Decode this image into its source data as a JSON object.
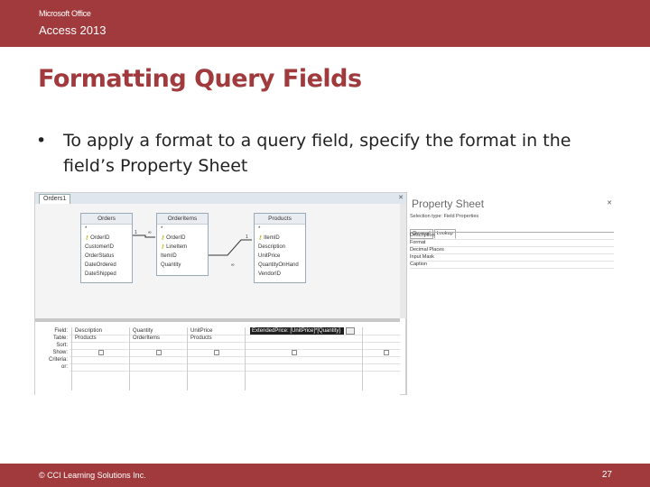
{
  "header": {
    "brand": "Microsoft Office",
    "product": "Access 2013"
  },
  "slide": {
    "title": "Formatting Query Fields",
    "bullet_mark": "•",
    "bullet": "To apply a format to a query field, specify the format in the field’s Property Sheet"
  },
  "footer": {
    "copyright": "© CCI Learning Solutions Inc.",
    "page": "27"
  },
  "screenshot": {
    "tab_label": "Orders1",
    "tables": [
      {
        "name": "Orders",
        "fields": [
          "*",
          "OrderID",
          "CustomerID",
          "OrderStatus",
          "DateOrdered",
          "DateShipped"
        ],
        "key_rows": [
          1
        ]
      },
      {
        "name": "OrderItems",
        "fields": [
          "*",
          "OrderID",
          "LineItem",
          "ItemID",
          "Quantity"
        ],
        "key_rows": [
          1,
          2
        ]
      },
      {
        "name": "Products",
        "fields": [
          "*",
          "ItemID",
          "Description",
          "UnitPrice",
          "QuantityOnHand",
          "VendorID"
        ],
        "key_rows": [
          1
        ]
      }
    ],
    "grid": {
      "row_labels": [
        "Field:",
        "Table:",
        "Sort:",
        "Show:",
        "Criteria:",
        "or:"
      ],
      "columns": [
        {
          "field": "Description",
          "table": "Products"
        },
        {
          "field": "Quantity",
          "table": "OrderItems"
        },
        {
          "field": "UnitPrice",
          "table": "Products"
        }
      ],
      "selected_field": "ExtendedPrice: [UnitPrice]*[Quantity]"
    },
    "property_sheet": {
      "title": "Property Sheet",
      "selection_type": "Selection type: Field Properties",
      "tabs": [
        "General",
        "Lookup"
      ],
      "properties": [
        "Description",
        "Format",
        "Decimal Places",
        "Input Mask",
        "Caption"
      ]
    }
  }
}
